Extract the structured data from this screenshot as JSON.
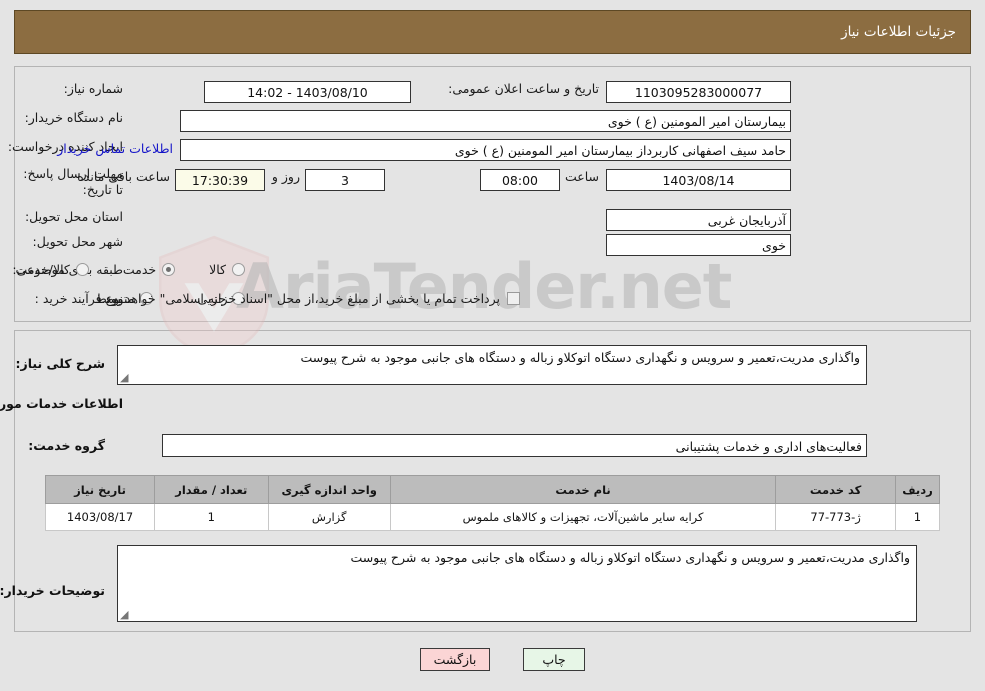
{
  "header": {
    "title": "جزئیات اطلاعات نیاز",
    "bar_color": "#8c6d41"
  },
  "watermark": {
    "text": "AriaTender.net"
  },
  "top_form": {
    "need_number": {
      "label": "شماره نیاز:",
      "value": "1103095283000077"
    },
    "announce_datetime": {
      "label": "تاریخ و ساعت اعلان عمومی:",
      "value": "1403/08/10 - 14:02"
    },
    "buyer_org": {
      "label": "نام دستگاه خریدار:",
      "value": "بیمارستان امیر المومنین (ع ) خوی"
    },
    "request_creator": {
      "label": "ایجاد کننده درخواست:",
      "value": "حامد سیف اصفهانی کاربرداز بیمارستان امیر المومنین (ع ) خوی"
    },
    "buyer_contact_link": "اطلاعات تماس خریدار",
    "deadline": {
      "label": "مهلت ارسال پاسخ: تا تاریخ:",
      "date": "1403/08/14",
      "hour_label": "ساعت",
      "hour": "08:00",
      "days_remaining": "3",
      "days_label": "روز و",
      "time_remaining": "17:30:39",
      "remaining_label": "ساعت باقی مانده"
    },
    "province": {
      "label": "استان محل تحویل:",
      "value": "آذربایجان غربی"
    },
    "city": {
      "label": "شهر محل تحویل:",
      "value": "خوی"
    },
    "category": {
      "label": "طبقه بندی موضوعی:",
      "options": [
        {
          "label": "کالا",
          "selected": false
        },
        {
          "label": "خدمت",
          "selected": true
        },
        {
          "label": "کالا/خدمت",
          "selected": false
        }
      ]
    },
    "purchase_type": {
      "label": "نوع فرآیند خرید :",
      "options": [
        {
          "label": "جزیی",
          "selected": false
        },
        {
          "label": "متوسط",
          "selected": false
        }
      ],
      "treasury_checkbox": {
        "checked": false,
        "label": "پرداخت تمام یا بخشی از مبلغ خرید،از محل \"اسناد خزانه اسلامی\" خواهد بود."
      }
    }
  },
  "need_summary": {
    "label": "شرح کلی نیاز:",
    "value": "واگذاری مدریت،تعمیر و سرویس و نگهداری دستگاه اتوکلاو زباله و دستگاه های جانبی موجود به شرح پیوست"
  },
  "services_section": {
    "heading": "اطلاعات خدمات مورد نیاز",
    "service_group": {
      "label": "گروه خدمت:",
      "value": "فعالیت‌های اداری و خدمات پشتیبانی"
    },
    "table": {
      "columns": [
        "ردیف",
        "کد خدمت",
        "نام خدمت",
        "واحد اندازه گیری",
        "تعداد / مقدار",
        "تاریخ نیاز"
      ],
      "rows": [
        [
          "1",
          "ژ-773-77",
          "کرایه سایر ماشین‌آلات، تجهیزات و کالاهای ملموس",
          "گزارش",
          "1",
          "1403/08/17"
        ]
      ]
    }
  },
  "buyer_notes": {
    "label": "توضیحات خریدار:",
    "value": "واگذاری مدریت،تعمیر و سرویس و نگهداری دستگاه اتوکلاو زباله و دستگاه های جانبی موجود به شرح پیوست"
  },
  "footer": {
    "back_button": "بازگشت",
    "print_button": "چاپ"
  }
}
